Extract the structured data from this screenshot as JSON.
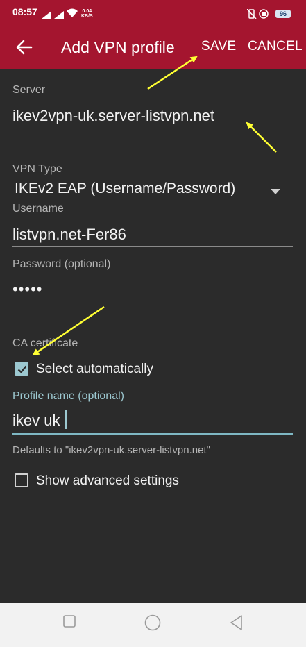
{
  "status_bar": {
    "time": "08:57",
    "speed_value": "0.04",
    "speed_unit": "KB/S",
    "battery": "96"
  },
  "app_bar": {
    "title": "Add VPN profile",
    "save_label": "SAVE",
    "cancel_label": "CANCEL",
    "color": "#a4152f"
  },
  "form": {
    "server": {
      "label": "Server",
      "value": "ikev2vpn-uk.server-listvpn.net"
    },
    "vpn_type": {
      "label": "VPN Type",
      "value": "IKEv2 EAP (Username/Password)"
    },
    "username": {
      "label": "Username",
      "value": "listvpn.net-Fer86"
    },
    "password": {
      "label": "Password (optional)",
      "value": "•••••"
    },
    "ca_certificate": {
      "label": "CA certificate",
      "select_auto_label": "Select automatically",
      "checked": true
    },
    "profile_name": {
      "label": "Profile name (optional)",
      "value": "ikev uk",
      "helper": "Defaults to \"ikev2vpn-uk.server-listvpn.net\""
    },
    "advanced": {
      "label": "Show advanced settings",
      "checked": false
    }
  },
  "colors": {
    "accent": "#9cc8d0",
    "annotation_arrow": "#ffff33"
  }
}
